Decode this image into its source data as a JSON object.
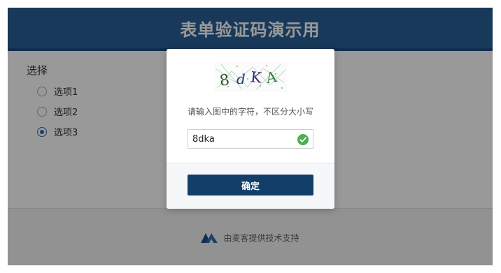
{
  "header": {
    "title": "表单验证码演示用"
  },
  "question": {
    "title": "选择",
    "options": [
      {
        "label": "选项1",
        "checked": false
      },
      {
        "label": "选项2",
        "checked": false
      },
      {
        "label": "选项3",
        "checked": true
      }
    ]
  },
  "footer": {
    "text": "由麦客提供技术支持",
    "logo_icon": "maike-logo-icon"
  },
  "captcha_modal": {
    "captcha_text": "8dKA",
    "hint": "请输入图中的字符，不区分大小写",
    "input_value": "8dka",
    "valid_icon": "check-circle-icon",
    "confirm_label": "确定"
  },
  "colors": {
    "header_bg": "#2b5f98",
    "radio_accent": "#2b6cb0",
    "confirm_btn": "#133e6a",
    "valid_green": "#4caf50"
  }
}
